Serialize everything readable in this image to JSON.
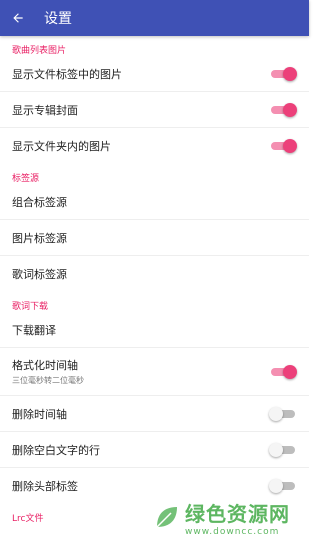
{
  "app_bar": {
    "title": "设置"
  },
  "sections": {
    "song_list_images": {
      "header": "歌曲列表图片",
      "items": [
        {
          "label": "显示文件标签中的图片",
          "on": true
        },
        {
          "label": "显示专辑封面",
          "on": true
        },
        {
          "label": "显示文件夹内的图片",
          "on": true
        }
      ]
    },
    "tag_source": {
      "header": "标签源",
      "items": [
        {
          "label": "组合标签源"
        },
        {
          "label": "图片标签源"
        },
        {
          "label": "歌词标签源"
        }
      ]
    },
    "lyrics_download": {
      "header": "歌词下载",
      "items": [
        {
          "label": "下载翻译"
        },
        {
          "label": "格式化时间轴",
          "sublabel": "三位毫秒转二位毫秒",
          "on": true
        },
        {
          "label": "删除时间轴",
          "on": false
        },
        {
          "label": "删除空白文字的行",
          "on": false
        },
        {
          "label": "删除头部标签",
          "on": false
        }
      ]
    },
    "lrc_file": {
      "header": "Lrc文件"
    }
  },
  "colors": {
    "app_bar": "#3f51b5",
    "accent": "#e91e63",
    "switch_on": "#ec407a"
  },
  "watermark": {
    "main": "绿色资源网",
    "sub": "www.downcc.com"
  }
}
